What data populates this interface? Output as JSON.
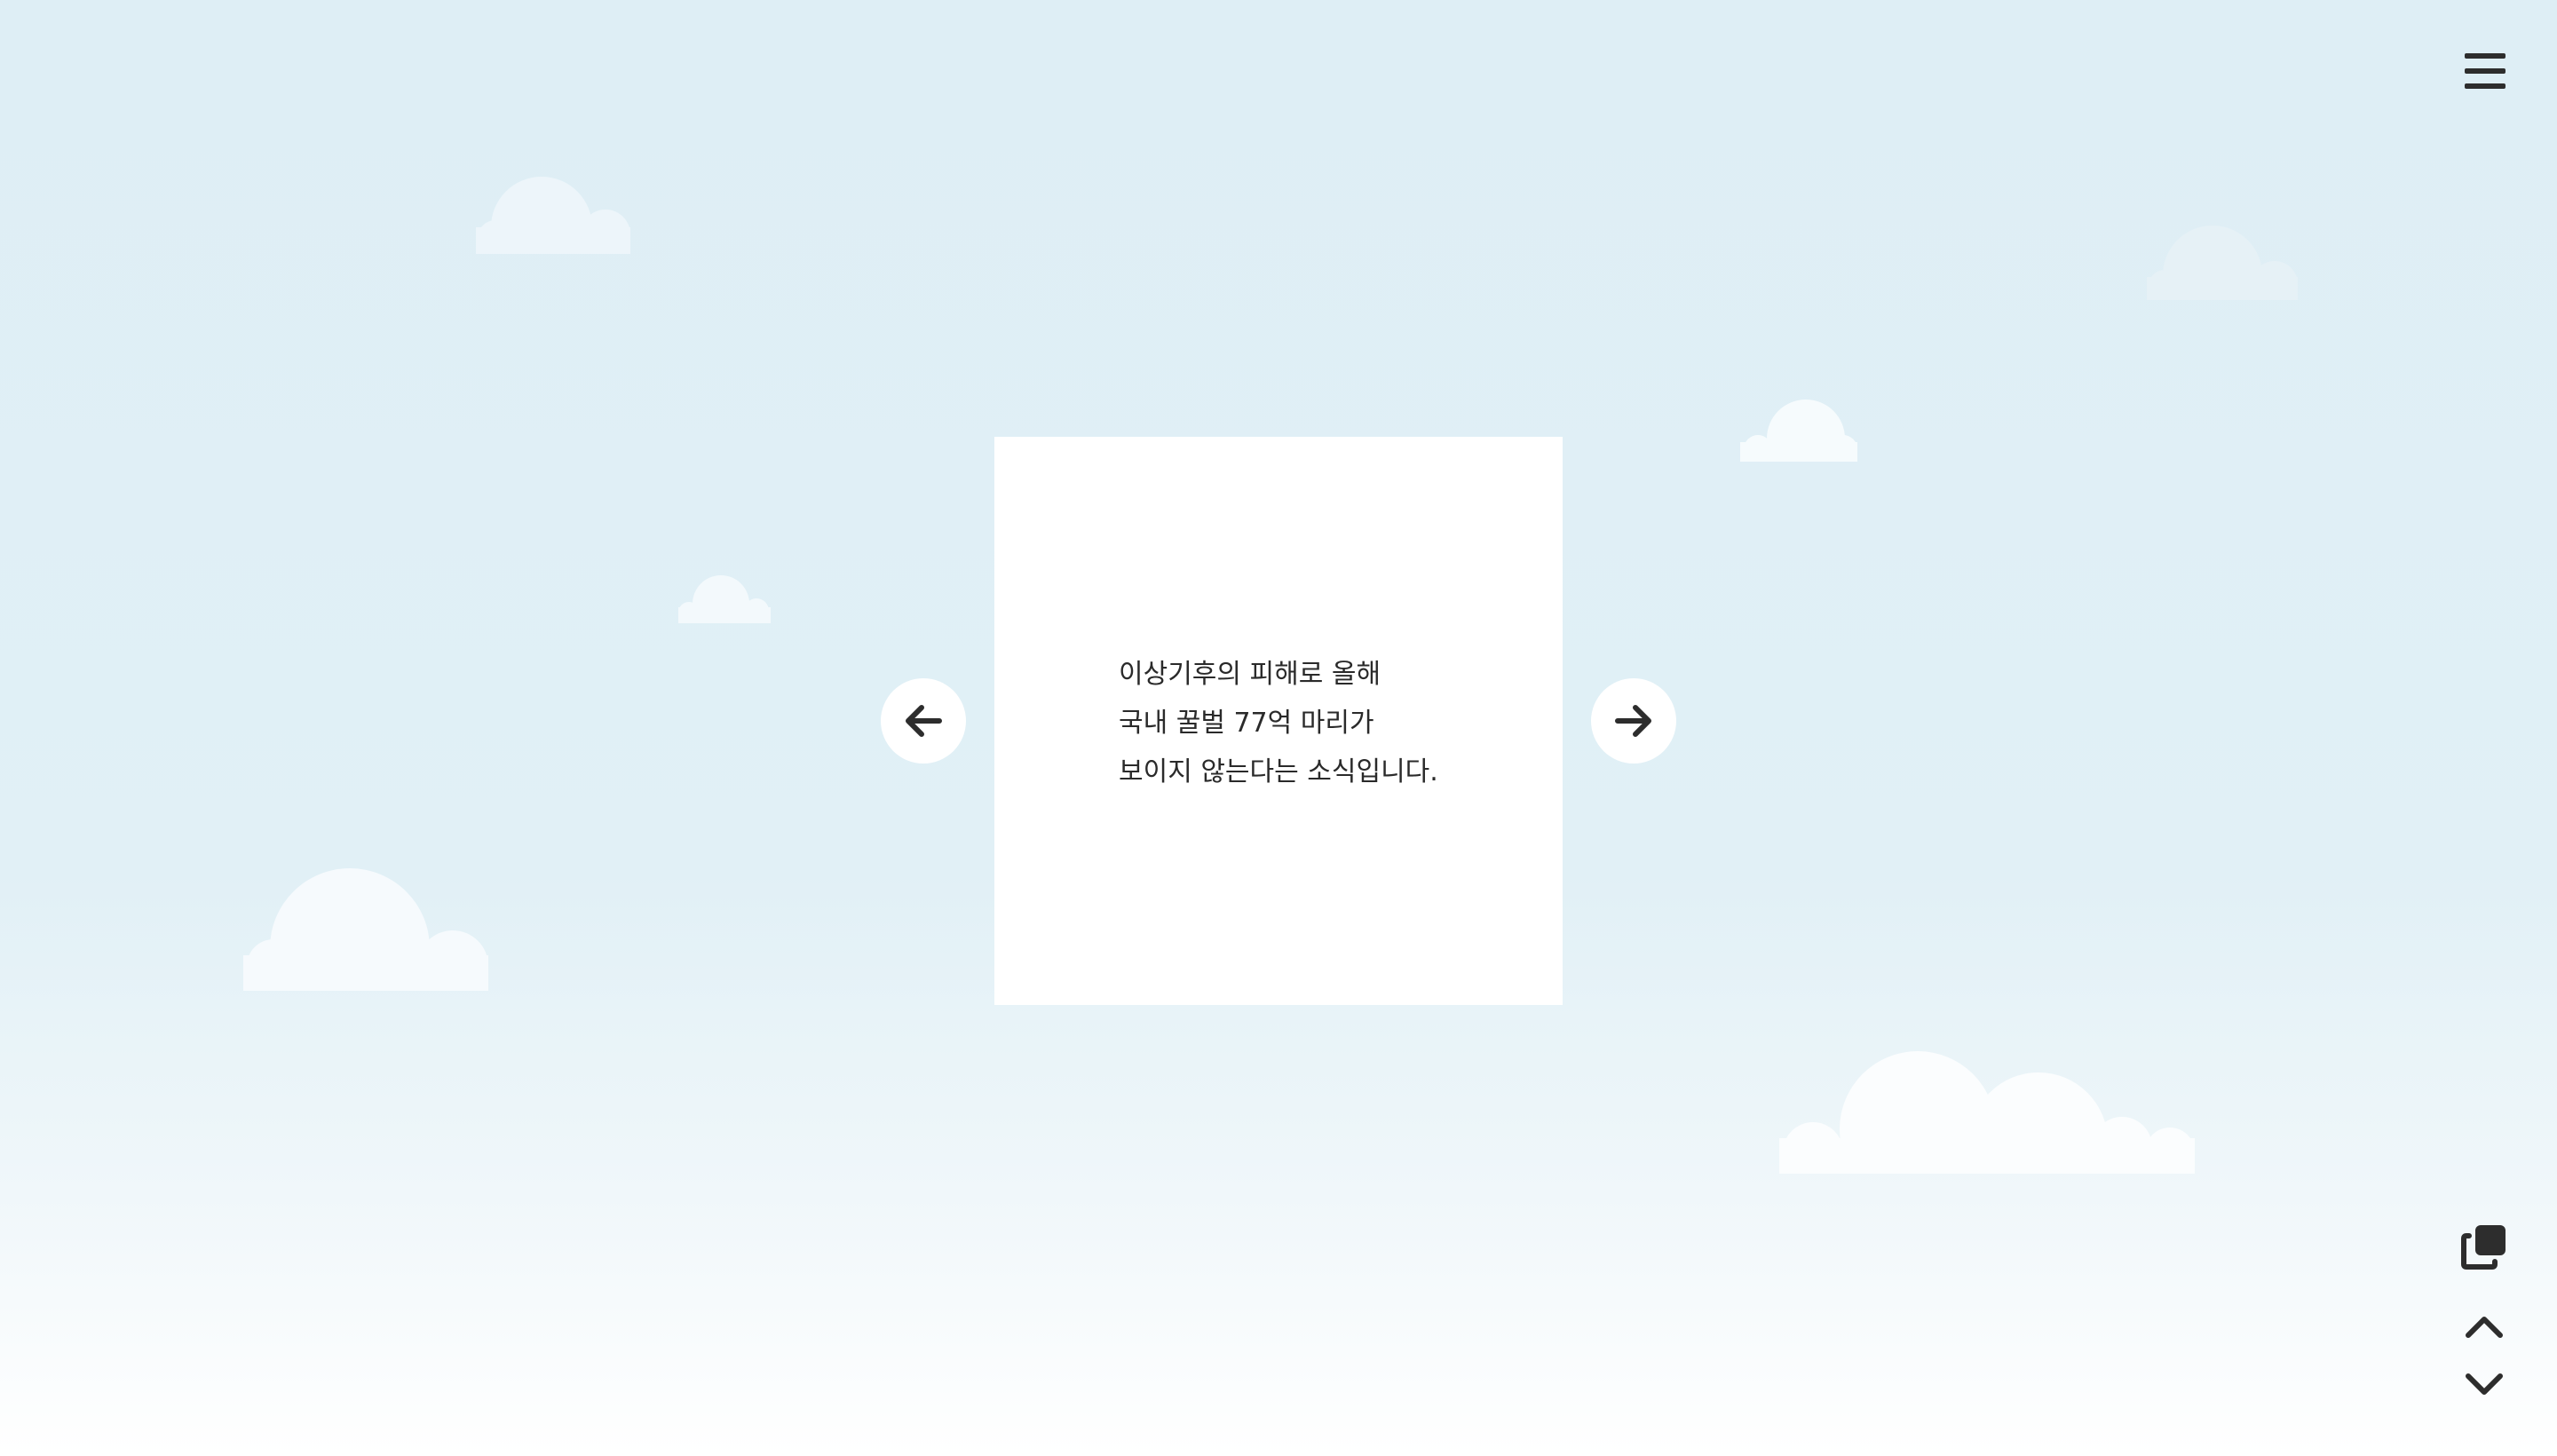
{
  "card": {
    "lines": [
      "이상기후의 피해로 올해",
      "국내 꿀벌 77억 마리가",
      "보이지 않는다는 소식입니다."
    ]
  },
  "icons": {
    "prev": "arrow-left-icon",
    "next": "arrow-right-icon",
    "menu": "hamburger-menu-icon",
    "copy": "copy-icon",
    "up": "chevron-up-icon",
    "down": "chevron-down-icon"
  },
  "colors": {
    "background_top": "#deeef5",
    "background_bottom": "#ffffff",
    "card": "#ffffff",
    "text": "#2a2a2a",
    "icon": "#2d2d2d",
    "cloud": "#f4f9fc"
  }
}
